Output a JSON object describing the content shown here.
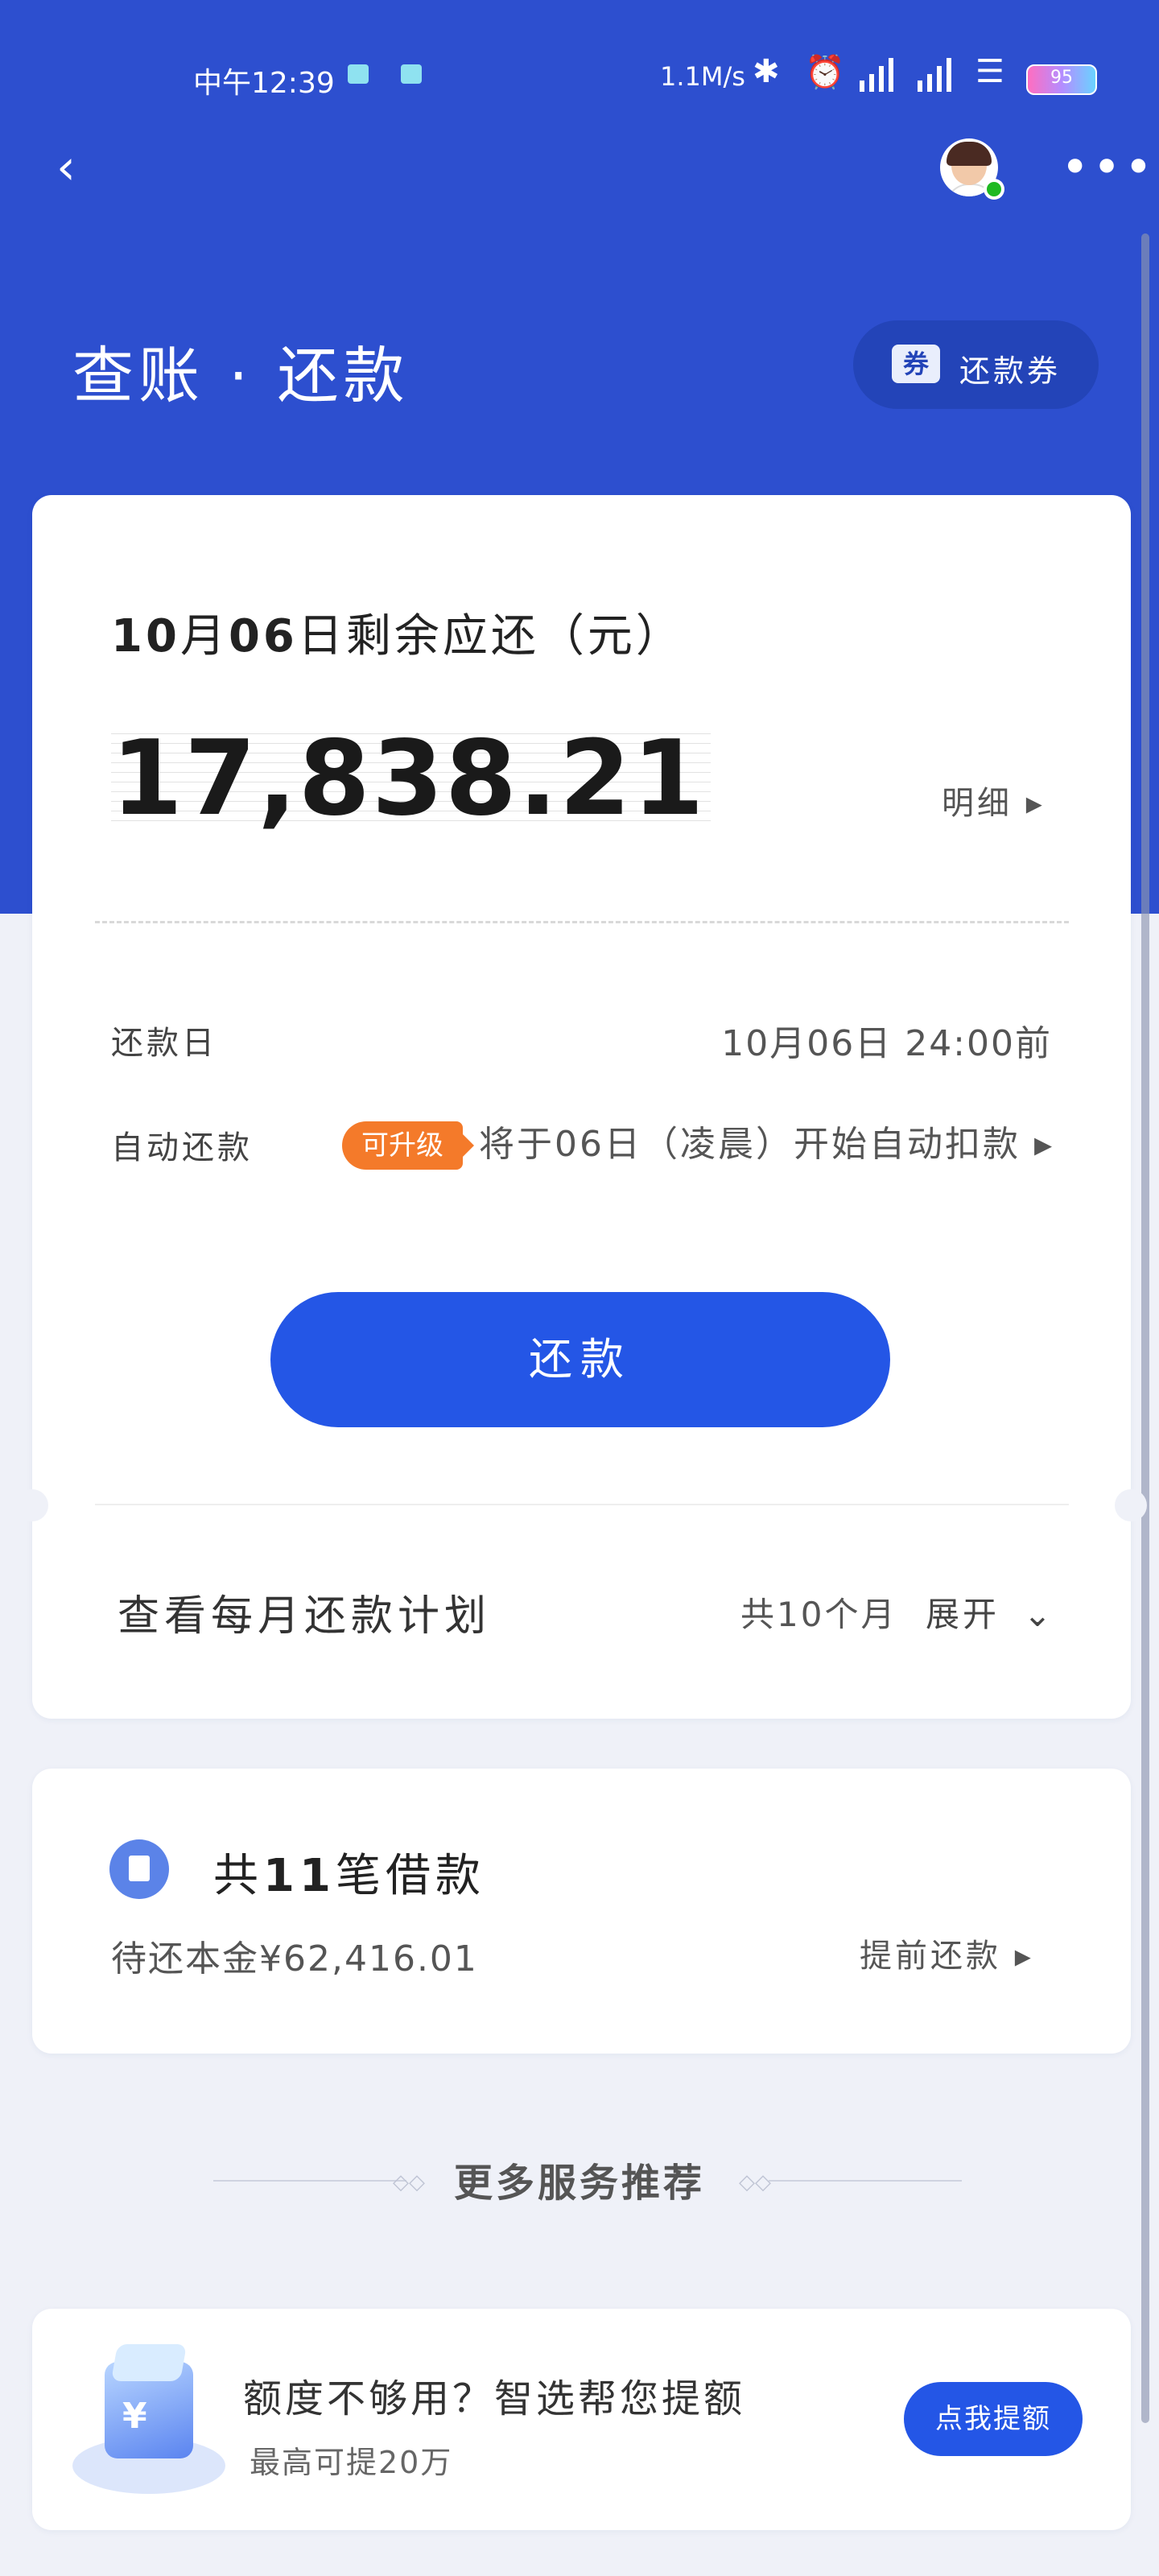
{
  "status_bar": {
    "time": "中午12:39",
    "network_speed": "1.1M/s",
    "battery": "95",
    "icons": [
      "cloud-icon",
      "app-icon",
      "bluetooth-icon",
      "alarm-icon",
      "hd-signal-icon",
      "hd-signal-icon",
      "wifi-icon",
      "battery-icon"
    ]
  },
  "header": {
    "back_icon": "chevron-left-icon",
    "more_label": "•••",
    "title": "查账 · 还款",
    "coupon_tag": "券",
    "coupon_label": "还款券"
  },
  "bill": {
    "due_month": "10",
    "due_month_unit": "月",
    "due_day": "06",
    "due_suffix": "日剩余应还（元）",
    "amount": "17,838.21",
    "detail_label": "明细 ▸",
    "repay_date_label": "还款日",
    "repay_date_value": "10月06日 24:00前",
    "auto_repay_label": "自动还款",
    "upgrade_badge": "可升级",
    "auto_repay_text": "将于06日（凌晨）开始自动扣款 ▸",
    "pay_button": "还款",
    "plan_label": "查看每月还款计划",
    "plan_count": "共10个月",
    "plan_expand": "展开",
    "expand_icon": "chevron-down-icon"
  },
  "loans": {
    "icon": "document-icon",
    "prefix": "共",
    "count": "11",
    "suffix": "笔借款",
    "principal": "待还本金¥62,416.01",
    "prepay_label": "提前还款 ▸"
  },
  "recommend": {
    "heading": "更多服务推荐",
    "promo_title": "额度不够用？智选帮您提额",
    "promo_sub": "最高可提20万",
    "promo_button": "点我提额",
    "promo_icon": "credit-cube-icon"
  },
  "colors": {
    "brand_blue": "#2d4fcf",
    "button_blue": "#2456e6",
    "badge_orange": "#f47a2a",
    "background": "#eff1f8"
  }
}
